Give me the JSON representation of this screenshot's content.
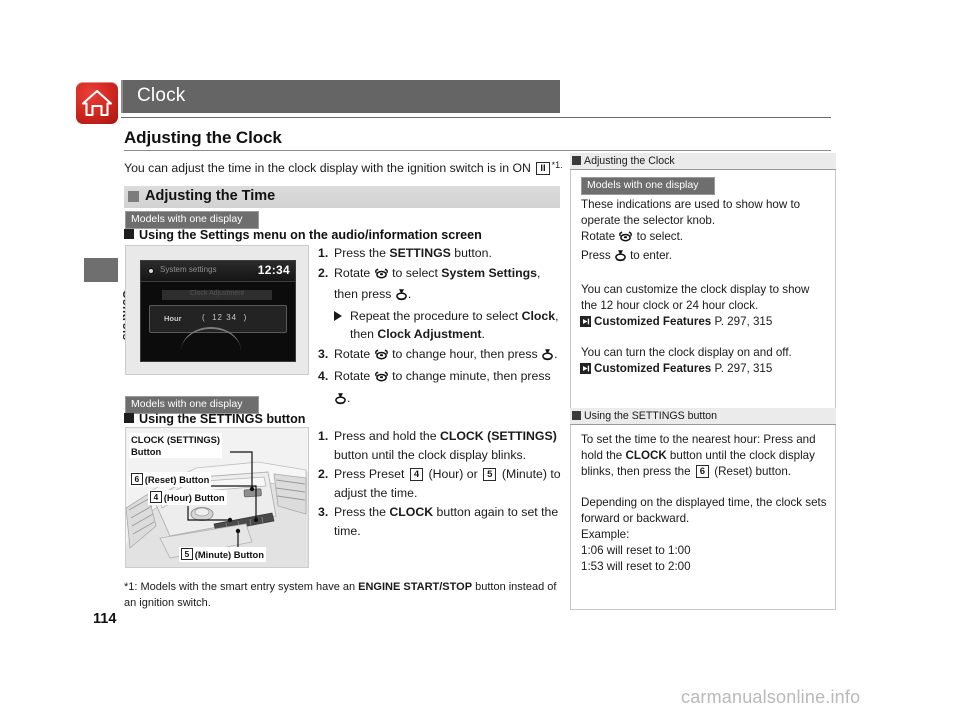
{
  "header": {
    "home_icon": "home-icon",
    "chapter_title": "Clock"
  },
  "side_tab": {
    "label": "Controls"
  },
  "main": {
    "h1": "Adjusting the Clock",
    "intro_prefix": "You can adjust the time in the clock display with the ignition switch is in ON ",
    "intro_keycap": "II",
    "intro_suffix": "*1.",
    "section_h2": "Adjusting the Time",
    "badge_1": "Models with one display",
    "h3_1": "Using the Settings menu on the audio/information screen",
    "badge_2": "Models with one display",
    "h3_2": "Using the SETTINGS button",
    "steps_a": [
      {
        "num": "1.",
        "parts": [
          {
            "t": "Press the "
          },
          {
            "t": "SETTINGS",
            "b": true
          },
          {
            "t": " button."
          }
        ]
      },
      {
        "num": "2.",
        "parts": [
          {
            "t": "Rotate "
          },
          {
            "icon": "rotate-knob-icon"
          },
          {
            "t": " to select "
          },
          {
            "t": "System Settings",
            "b": true
          },
          {
            "t": ", then press "
          },
          {
            "icon": "press-knob-icon"
          },
          {
            "t": "."
          }
        ],
        "sub": [
          {
            "t": "Repeat the procedure to select "
          },
          {
            "t": "Clock",
            "b": true
          },
          {
            "t": ", then "
          },
          {
            "t": "Clock Adjustment",
            "b": true
          },
          {
            "t": "."
          }
        ]
      },
      {
        "num": "3.",
        "parts": [
          {
            "t": "Rotate "
          },
          {
            "icon": "rotate-knob-icon"
          },
          {
            "t": " to change hour, then press "
          },
          {
            "icon": "press-knob-icon"
          },
          {
            "t": "."
          }
        ]
      },
      {
        "num": "4.",
        "parts": [
          {
            "t": "Rotate "
          },
          {
            "icon": "rotate-knob-icon"
          },
          {
            "t": " to change minute, then press "
          },
          {
            "icon": "press-knob-icon"
          },
          {
            "t": "."
          }
        ]
      }
    ],
    "steps_b": [
      {
        "num": "1.",
        "parts": [
          {
            "t": "Press and hold the "
          },
          {
            "t": "CLOCK (SETTINGS)",
            "b": true
          },
          {
            "t": " button until the clock display blinks."
          }
        ]
      },
      {
        "num": "2.",
        "parts": [
          {
            "t": "Press Preset "
          },
          {
            "key": "4"
          },
          {
            "t": " (Hour) or "
          },
          {
            "key": "5"
          },
          {
            "t": " (Minute) to adjust the time."
          }
        ]
      },
      {
        "num": "3.",
        "parts": [
          {
            "t": "Press the "
          },
          {
            "t": "CLOCK",
            "b": true
          },
          {
            "t": " button again to set the time."
          }
        ]
      }
    ],
    "figure_audio": {
      "screen_title": "System settings",
      "clock": "12:34",
      "dim_row": "Clock Adjustment",
      "row_label": "Hour",
      "row_value": "12 34"
    },
    "figure_dashboard": {
      "callouts": [
        {
          "key": "",
          "text": "CLOCK (SETTINGS)"
        },
        {
          "key": "",
          "text": "Button"
        },
        {
          "key": "6",
          "text": "(Reset) Button"
        },
        {
          "key": "4",
          "text": "(Hour) Button"
        },
        {
          "key": "5",
          "text": "(Minute) Button"
        }
      ]
    },
    "footnote": {
      "prefix": "*1: Models with the smart entry system have an ",
      "bold": "ENGINE START/STOP",
      "suffix": " button instead of an ignition switch."
    },
    "page_number": "114"
  },
  "sidebar": {
    "panel_1": {
      "heading": "Adjusting the Clock",
      "badge": "Models with one display",
      "line_1": "These indications are used to show how to operate the selector knob.",
      "line_2_prefix": "Rotate ",
      "line_2_suffix": " to select.",
      "line_3_prefix": "Press ",
      "line_3_suffix": " to enter.",
      "para_2": "You can customize the clock display to show the 12 hour clock or 24 hour clock.",
      "ref_1_label": "Customized Features",
      "ref_1_page": "P. 297, 315",
      "para_3": "You can turn the clock display on and off.",
      "ref_2_label": "Customized Features",
      "ref_2_page": "P. 297, 315"
    },
    "panel_2": {
      "heading": "Using the SETTINGS button",
      "para_1_a": "To set the time to the nearest hour: Press and hold the ",
      "para_1_bold": "CLOCK",
      "para_1_b": " button until the clock display blinks, then press the ",
      "para_1_key": "6",
      "para_1_c": " (Reset) button.",
      "para_2_l1": "Depending on the displayed time, the clock sets forward or backward.",
      "para_2_l2": "Example:",
      "para_2_l3": "1:06 will reset to 1:00",
      "para_2_l4": "1:53 will reset to 2:00"
    }
  },
  "watermark": "carmanualsonline.info",
  "colors": {
    "title_bar": "#656565",
    "home_icon_red": "#cf2a22",
    "badge_gray": "#6e6e6e",
    "h2_gray": "#d6d6d6"
  }
}
